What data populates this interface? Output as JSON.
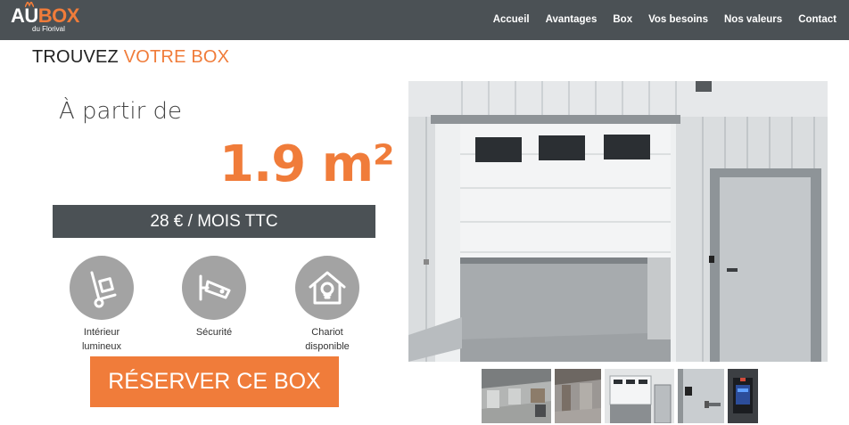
{
  "brand": {
    "name_part1": "AU",
    "name_part2": "BOX",
    "subtitle": "du Florival",
    "accent_color": "#f07c3a",
    "nav_bg": "#4b5155"
  },
  "nav": {
    "items": [
      {
        "label": "Accueil"
      },
      {
        "label": "Avantages"
      },
      {
        "label": "Box"
      },
      {
        "label": "Vos besoins"
      },
      {
        "label": "Nos valeurs"
      },
      {
        "label": "Contact"
      }
    ]
  },
  "page": {
    "title_part1": "TROUVEZ ",
    "title_part2": "VOTRE BOX",
    "from_label": "À partir de",
    "size": "1.9 m²",
    "price": "28 € / MOIS TTC",
    "reserve_label": "RÉSERVER CE BOX"
  },
  "features": [
    {
      "label_line1": "Intérieur",
      "label_line2": "lumineux",
      "icon": "trolley-icon"
    },
    {
      "label_line1": "Sécurité",
      "label_line2": "",
      "icon": "camera-icon"
    },
    {
      "label_line1": "Chariot",
      "label_line2": "disponible",
      "icon": "house-bulb-icon"
    }
  ],
  "gallery": {
    "main_photo": "garage-door-photo",
    "thumbnails": [
      "corridor-photo",
      "box-interior-photo",
      "garage-door-photo",
      "door-handle-photo",
      "keypad-photo"
    ]
  }
}
